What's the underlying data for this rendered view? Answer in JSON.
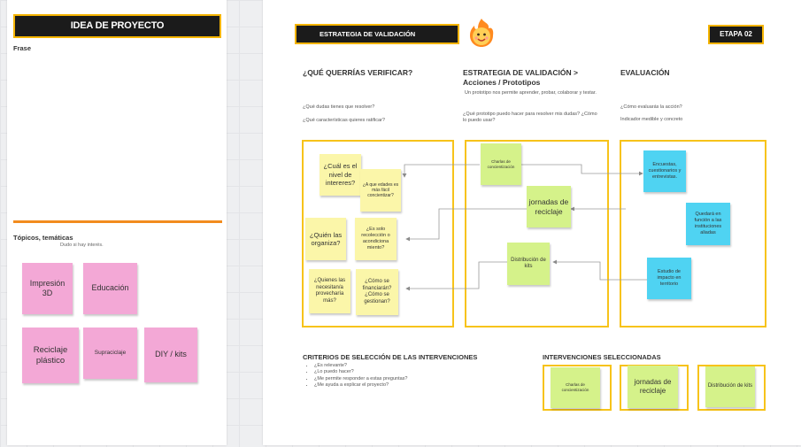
{
  "left_panel": {
    "header": "IDEA DE PROYECTO",
    "phrase_label": "Frase",
    "topics_label": "Tópicos, temáticas",
    "topics_hint": "Dudo si hay interés.",
    "stickies": [
      "Impresión 3D",
      "Educación",
      "Reciclaje plástico",
      "Supraciclaje",
      "DIY / kits"
    ]
  },
  "main_panel": {
    "header": "ESTRATEGIA DE VALIDACIÓN",
    "stage": "ETAPA 02",
    "emoji_icon": "fire-face-icon",
    "col1": {
      "title": "¿QUÉ QUERRÍAS VERIFICAR?",
      "q1": "¿Qué dudas tienes que resolver?",
      "q2": "¿Qué características quieres ratificar?"
    },
    "col2": {
      "title_line1": "ESTRATEGIA DE VALIDACIÓN >",
      "title_line2": "Acciones / Prototipos",
      "desc": "Un prototipo nos permite aprender, probar, colaborar y testar.",
      "q": "¿Qué prototipo puedo hacer para resolver mis dudas? ¿Cómo lo puedo usar?"
    },
    "col3": {
      "title": "EVALUACIÓN",
      "q1": "¿Cómo evaluarás la acción?",
      "q2": "Indicador medible y concreto"
    },
    "verify_stickies": [
      "¿Cuál es el nivel de intereres?",
      "¿A que edades es más fácil concientizar?",
      "¿Quién las organiza?",
      "¿Es solo recolección o acondiciona miento?",
      "¿Quienes las necesitan/a provecharía más?",
      "¿Cómo se financiarán? ¿Cómo se gestionan?"
    ],
    "action_stickies": [
      "Charlas de concientización",
      "jornadas de reciclaje",
      "Distribución de kits"
    ],
    "eval_stickies": [
      "Encuestas, cuestionarios y entrevistas.",
      "Quedará en función a las instituciones aliadas",
      "Estudio de impacto en territorio"
    ],
    "criteria": {
      "title": "CRITERIOS DE SELECCIÓN DE LAS INTERVENCIONES",
      "items": [
        "¿Es relevante?",
        "¿Lo puedo hacer?",
        "¿Me permite responder a estas preguntas?",
        "¿Me ayuda a explicar el proyecto?"
      ]
    },
    "selected": {
      "title": "INTERVENCIONES SELECCIONADAS",
      "items": [
        "Charlas de concientización",
        "jornadas de reciclaje",
        "Distribución de kits"
      ]
    }
  },
  "colors": {
    "accent_yellow": "#f7c31a",
    "orange_divider": "#f28c1e",
    "header_dark": "#1b1b1b",
    "pink": "#f3a8d6",
    "yellow_note": "#fbf6a9",
    "green_note": "#d5f28a",
    "blue_note": "#4fd3f2"
  }
}
